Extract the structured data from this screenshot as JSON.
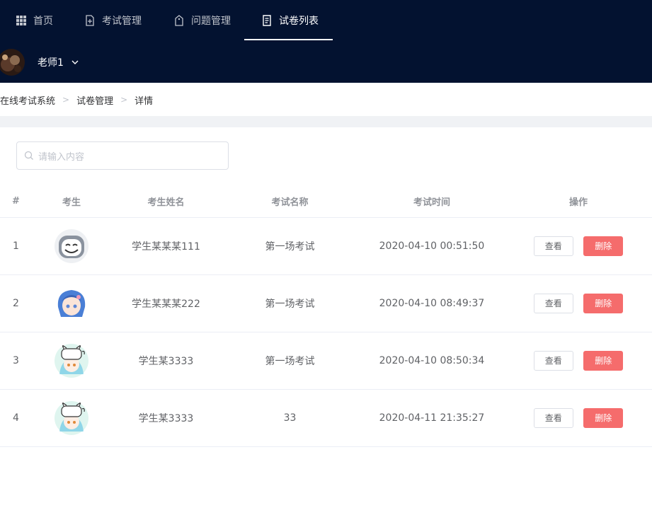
{
  "nav": {
    "items": [
      {
        "label": "首页",
        "icon": "grid-icon"
      },
      {
        "label": "考试管理",
        "icon": "file-add-icon"
      },
      {
        "label": "问题管理",
        "icon": "tag-icon"
      },
      {
        "label": "试卷列表",
        "icon": "document-icon",
        "active": true
      }
    ],
    "user": {
      "name": "老师1"
    }
  },
  "breadcrumb": [
    "在线考试系统",
    "试卷管理",
    "详情"
  ],
  "search": {
    "placeholder": "请输入内容"
  },
  "table": {
    "headers": [
      "#",
      "考生",
      "考生姓名",
      "考试名称",
      "考试时间",
      "操作"
    ],
    "rows": [
      {
        "index": "1",
        "avatar": "robot-avatar",
        "name": "学生某某某111",
        "exam": "第一场考试",
        "time": "2020-04-10 00:51:50"
      },
      {
        "index": "2",
        "avatar": "anime-girl-avatar",
        "name": "学生某某某222",
        "exam": "第一场考试",
        "time": "2020-04-10 08:49:37"
      },
      {
        "index": "3",
        "avatar": "anime-cat-avatar",
        "name": "学生某3333",
        "exam": "第一场考试",
        "time": "2020-04-10 08:50:34"
      },
      {
        "index": "4",
        "avatar": "anime-cat-avatar",
        "name": "学生某3333",
        "exam": "33",
        "time": "2020-04-11 21:35:27"
      }
    ],
    "actions": {
      "view": "查看",
      "delete": "删除"
    }
  },
  "colors": {
    "nav_bg": "#031230",
    "danger": "#f56c6c",
    "border": "#ebeef5"
  }
}
